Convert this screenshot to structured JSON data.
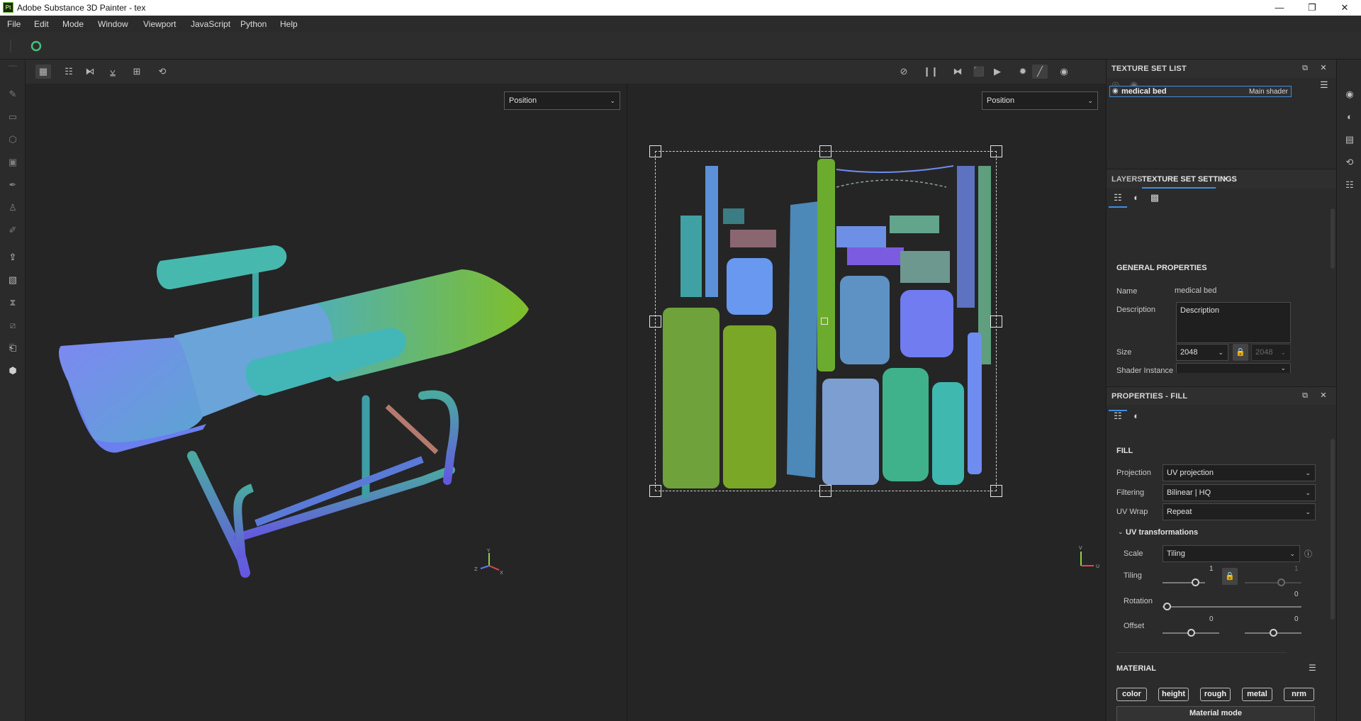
{
  "window": {
    "title": "Adobe Substance 3D Painter - tex",
    "logo": "Pt"
  },
  "menu": [
    "File",
    "Edit",
    "Mode",
    "Window",
    "Viewport",
    "JavaScript",
    "Python",
    "Help"
  ],
  "viewport3d": {
    "channel": "Position"
  },
  "viewport2d": {
    "channel": "Position"
  },
  "texture_set_list": {
    "title": "TEXTURE SET LIST",
    "item_name": "medical bed",
    "item_shader": "Main shader"
  },
  "tabs": {
    "layers": "LAYERS",
    "tss": "TEXTURE SET SETTINGS"
  },
  "general": {
    "section": "GENERAL PROPERTIES",
    "name_label": "Name",
    "name_value": "medical bed",
    "desc_label": "Description",
    "desc_value": "Description",
    "size_label": "Size",
    "size_value": "2048",
    "size_locked": "2048",
    "shader_label": "Shader Instance"
  },
  "fill": {
    "title": "PROPERTIES - FILL",
    "section": "FILL",
    "projection_label": "Projection",
    "projection_value": "UV projection",
    "filtering_label": "Filtering",
    "filtering_value": "Bilinear | HQ",
    "uvwrap_label": "UV Wrap",
    "uvwrap_value": "Repeat",
    "uvtrans_label": "UV transformations",
    "scale_label": "Scale",
    "scale_value": "Tiling",
    "tiling_label": "Tiling",
    "tiling_value": "1",
    "tiling_value2": "1",
    "rotation_label": "Rotation",
    "rotation_value": "0",
    "offset_label": "Offset",
    "offset_x": "0",
    "offset_y": "0"
  },
  "material": {
    "section": "MATERIAL",
    "buttons": [
      "color",
      "height",
      "rough",
      "metal",
      "nrm"
    ],
    "mode_label": "Material mode"
  },
  "colors": {
    "accent": "#3d8ee0",
    "uv_green": "#7fb21c",
    "uv_blue": "#6e8ff0",
    "uv_teal": "#4db7b0"
  }
}
